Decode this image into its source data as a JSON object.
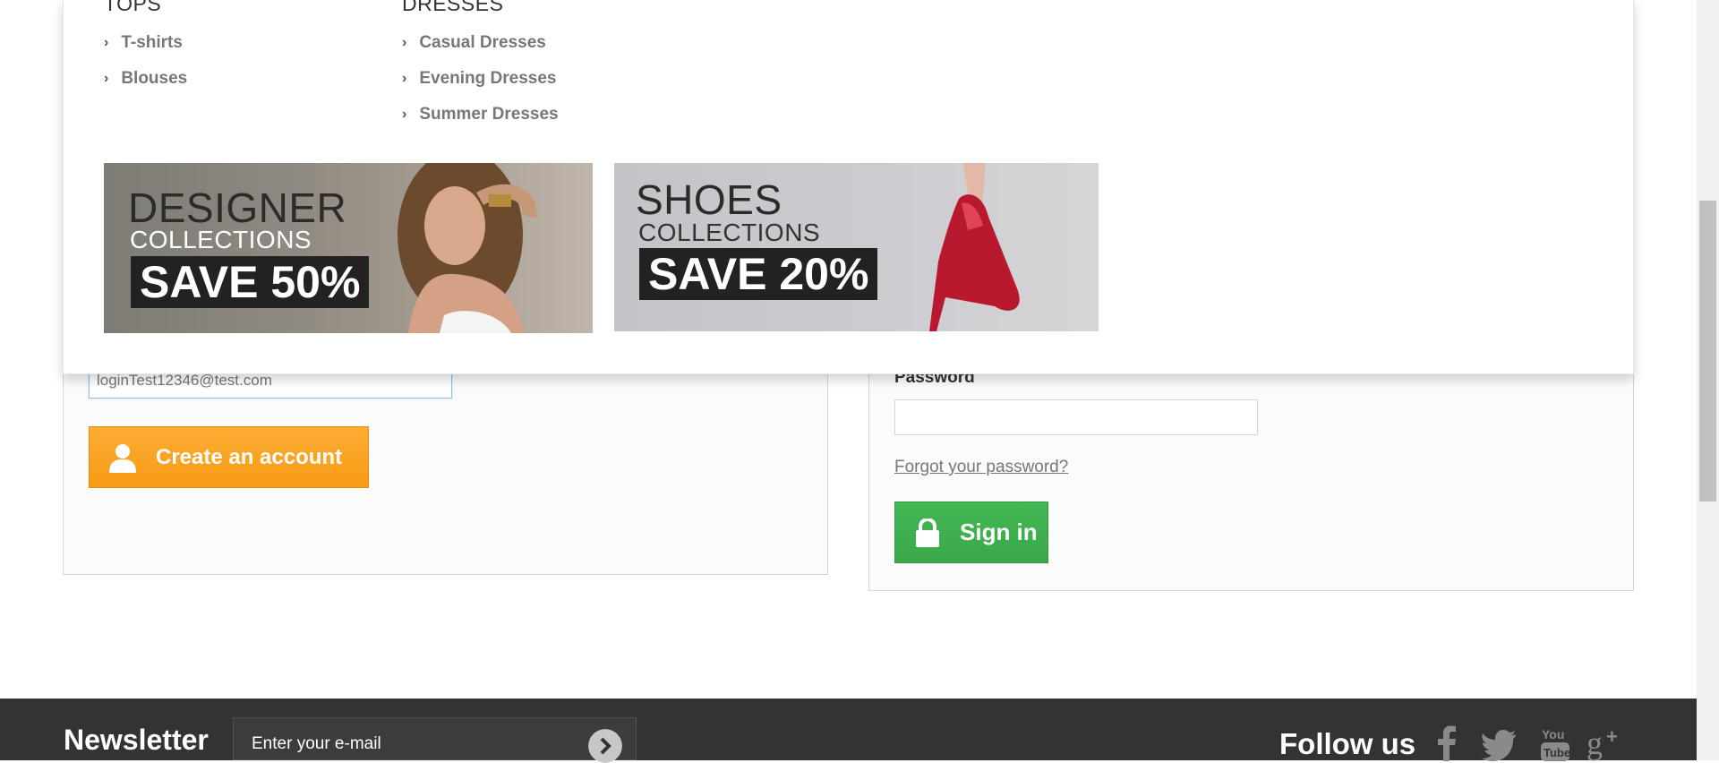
{
  "menu": {
    "tops": {
      "title": "TOPS",
      "items": [
        "T-shirts",
        "Blouses"
      ]
    },
    "dresses": {
      "title": "DRESSES",
      "items": [
        "Casual Dresses",
        "Evening Dresses",
        "Summer Dresses"
      ]
    },
    "banners": {
      "designer": {
        "line1": "DESIGNER",
        "line2": "COLLECTIONS",
        "save": "SAVE 50%"
      },
      "shoes": {
        "line1": "SHOES",
        "line2": "COLLECTIONS",
        "save": "SAVE 20%"
      }
    }
  },
  "create_account": {
    "email_value": "loginTest12346@test.com",
    "button_label": "Create an account"
  },
  "signin": {
    "password_label": "Password",
    "forgot_label": "Forgot your password?",
    "button_label": "Sign in"
  },
  "footer": {
    "newsletter_title": "Newsletter",
    "newsletter_placeholder": "Enter your e-mail",
    "follow_label": "Follow us",
    "social": [
      "facebook-icon",
      "twitter-icon",
      "youtube-icon",
      "google-plus-icon"
    ]
  },
  "colors": {
    "orange": "#f89a14",
    "green": "#3aa84a",
    "footer": "#333333"
  }
}
